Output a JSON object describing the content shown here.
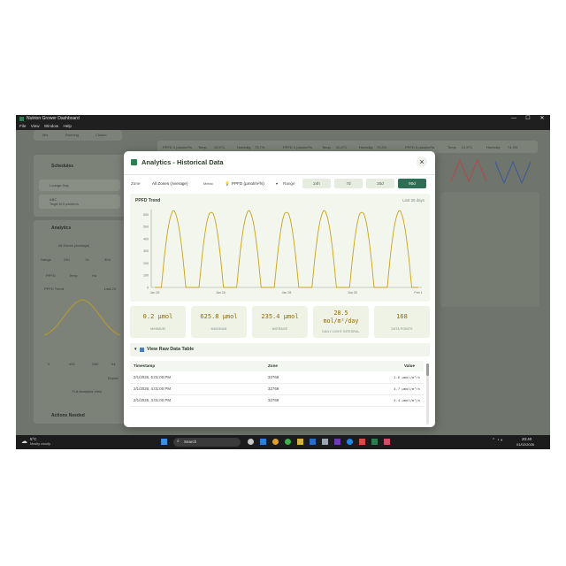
{
  "window": {
    "title": "Nutrion Grower Dashboard",
    "menu": [
      "File",
      "View",
      "Window",
      "Help"
    ],
    "controls": [
      "—",
      "☐",
      "✕"
    ]
  },
  "background": {
    "top_tabs": [
      "Mix",
      "Running",
      "Closed"
    ],
    "metrics_strip": [
      {
        "label": "PPFD",
        "value": "0 µmol/m²/s"
      },
      {
        "label": "Temp",
        "value": "19.9°C"
      },
      {
        "label": "Humidity",
        "value": "73.7%"
      },
      {
        "label": "PPFD",
        "value": "0 µmol/m²/s"
      },
      {
        "label": "Temp",
        "value": "20.4°C"
      },
      {
        "label": "Humidity",
        "value": "73.3%"
      },
      {
        "label": "PPFD",
        "value": "0 µmol/m²/s"
      },
      {
        "label": "Temp",
        "value": "21.9°C"
      },
      {
        "label": "Humidity",
        "value": "74.3%"
      }
    ],
    "schedules": {
      "title": "Schedules",
      "items": [
        {
          "name": "Lounge Day"
        },
        {
          "name": "ABC",
          "detail": "Target 10.5 µmol/m²/s"
        }
      ]
    },
    "analytics": {
      "title": "Analytics",
      "zone": "All Zones (Average)",
      "range_label": "Range",
      "ranges": [
        "24h",
        "7d",
        "30d"
      ],
      "metric_tabs": [
        "PPFD",
        "Temp",
        "Hu"
      ],
      "chart_title": "PPFD Trend",
      "chart_sub": "Last 24",
      "mini_stats": [
        "0",
        "452",
        "246",
        "64"
      ],
      "export_label": "Export",
      "full_button": "Full Analytics View"
    },
    "actions_title": "Actions Needed"
  },
  "modal": {
    "title": "Analytics - Historical Data",
    "filters": {
      "zone_label": "Zone",
      "zone_value": "All Zones (Average)",
      "metric_label": "Metric",
      "metric_value": "PPFD (µmol/m²/s)",
      "range_label": "Range",
      "ranges": [
        "24h",
        "7d",
        "30d",
        "90d"
      ],
      "active_range": "90d"
    },
    "chart": {
      "title": "PPFD Trend",
      "subtitle": "Last 30 days"
    },
    "stats": [
      {
        "value": "0.2 µmol",
        "label": "MINIMUM"
      },
      {
        "value": "625.8 µmol",
        "label": "MAXIMUM"
      },
      {
        "value": "235.4 µmol",
        "label": "AVERAGE"
      },
      {
        "value": "20.5\nmol/m²/day",
        "line1": "20.5",
        "line2": "mol/m²/day",
        "label": "DAILY LIGHT INTEGRAL"
      },
      {
        "value": "168",
        "label": "DATA POINTS"
      }
    ],
    "raw_table": {
      "toggle_label": "View Raw Data Table",
      "columns": [
        "Timestamp",
        "Zone",
        "Value"
      ],
      "rows": [
        {
          "timestamp": "2/1/2026, 5:01:00 PM",
          "zone": "32769",
          "value": "2.6 µmol/m²/s"
        },
        {
          "timestamp": "2/1/2026, 4:01:00 PM",
          "zone": "32769",
          "value": "4.7 µmol/m²/s"
        },
        {
          "timestamp": "2/1/2026, 3:01:00 PM",
          "zone": "32769",
          "value": "5.4 µmol/m²/s"
        }
      ]
    }
  },
  "chart_data": {
    "type": "line",
    "title": "PPFD Trend",
    "subtitle": "Last 30 days",
    "yticks": [
      "0",
      "100",
      "200",
      "300",
      "400",
      "500",
      "600"
    ],
    "xticks": [
      "Jan 25",
      "Jan 26",
      "Jan 28",
      "Jan 30",
      "Feb 1"
    ],
    "ylim": [
      0,
      640
    ],
    "grid": false,
    "line_color": "#c7a21a",
    "cycles": 7,
    "min": 0.2,
    "max": 625.8
  },
  "taskbar": {
    "weather_temp": "5°C",
    "weather_desc": "Mostly cloudy",
    "search_placeholder": "Search",
    "time": "20:40",
    "date": "01/02/2026"
  },
  "colors": {
    "accent": "#2e6e55",
    "stat_value": "#8d6a08",
    "chart_line": "#c7a21a"
  }
}
